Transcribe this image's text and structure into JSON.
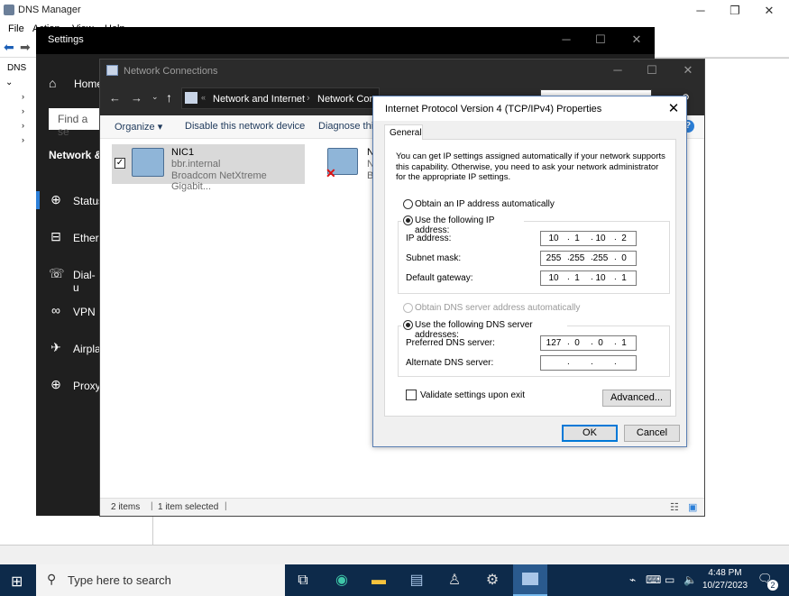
{
  "dns_manager": {
    "title": "DNS Manager",
    "menu": [
      "File",
      "Action",
      "View",
      "Help"
    ],
    "tree_root": "DNS"
  },
  "settings": {
    "title": "Settings",
    "home": "Home",
    "search_placeholder": "Find a se",
    "section": "Network &",
    "nav": [
      {
        "label": "Status",
        "icon": "globe-icon"
      },
      {
        "label": "Ethern",
        "icon": "ethernet-icon"
      },
      {
        "label": "Dial-u",
        "icon": "phone-icon"
      },
      {
        "label": "VPN",
        "icon": "vpn-icon"
      },
      {
        "label": "Airpla",
        "icon": "airplane-icon"
      },
      {
        "label": "Proxy",
        "icon": "globe-icon"
      }
    ]
  },
  "network_connections": {
    "title": "Network Connections",
    "breadcrumb": [
      "Network and Internet",
      "Network Con"
    ],
    "commands": [
      "Organize ▾",
      "Disable this network device",
      "Diagnose this"
    ],
    "adapters": [
      {
        "name": "NIC1",
        "network": "bbr.internal",
        "device": "Broadcom NetXtreme Gigabit..."
      },
      {
        "name": "N",
        "network": "N",
        "device": "B"
      }
    ],
    "status": {
      "items": "2 items",
      "selected": "1 item selected"
    }
  },
  "tcpip": {
    "title": "Internet Protocol Version 4 (TCP/IPv4) Properties",
    "tab": "General",
    "description": "You can get IP settings assigned automatically if your network supports this capability. Otherwise, you need to ask your network administrator for the appropriate IP settings.",
    "obtain_ip_auto": "Obtain an IP address automatically",
    "use_ip": "Use the following IP address:",
    "ip_label": "IP address:",
    "ip_value": [
      "10",
      "1",
      "10",
      "2"
    ],
    "subnet_label": "Subnet mask:",
    "subnet_value": [
      "255",
      "255",
      "255",
      "0"
    ],
    "gateway_label": "Default gateway:",
    "gateway_value": [
      "10",
      "1",
      "10",
      "1"
    ],
    "obtain_dns_auto": "Obtain DNS server address automatically",
    "use_dns": "Use the following DNS server addresses:",
    "preferred_label": "Preferred DNS server:",
    "preferred_value": [
      "127",
      "0",
      "0",
      "1"
    ],
    "alternate_label": "Alternate DNS server:",
    "alternate_value": [
      "",
      "",
      "",
      ""
    ],
    "validate": "Validate settings upon exit",
    "advanced": "Advanced...",
    "ok": "OK",
    "cancel": "Cancel"
  },
  "taskbar": {
    "search_placeholder": "Type here to search",
    "time": "4:48 PM",
    "date": "10/27/2023",
    "notifications": "2"
  },
  "colors": {
    "accent": "#2c7fd8",
    "taskbar": "#0d2a4a",
    "settings_bg": "#1f1f1f"
  }
}
